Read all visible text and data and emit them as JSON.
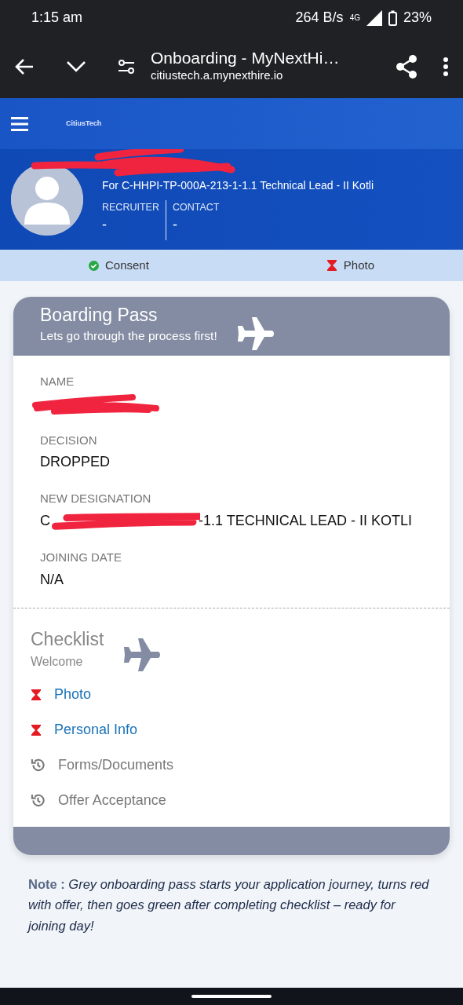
{
  "status_bar": {
    "time": "1:15 am",
    "speed": "264 B/s",
    "network": "4G",
    "battery": "23%"
  },
  "browser": {
    "title": "Onboarding - MyNextHi…",
    "url": "citiustech.a.mynexthire.io"
  },
  "header": {
    "logo": "CitiusTech"
  },
  "profile": {
    "for_label": "For",
    "position": "C-HHPI-TP-000A-213-1-1.1 Technical Lead - II Kotli",
    "fields": [
      {
        "label": "RECRUITER",
        "value": "-"
      },
      {
        "label": "CONTACT",
        "value": "-"
      }
    ]
  },
  "steps": [
    {
      "label": "Consent",
      "kind": "done"
    },
    {
      "label": "Photo",
      "kind": "pending"
    }
  ],
  "pass": {
    "title": "Boarding Pass",
    "subtitle": "Lets go through the process first!",
    "fields": [
      {
        "label": "NAME",
        "redacted": true
      },
      {
        "label": "DECISION",
        "value": "DROPPED"
      },
      {
        "label": "NEW DESIGNATION",
        "value_start": "C",
        "value": "-1.1 TECHNICAL LEAD - II KOTLI",
        "redacted": true
      },
      {
        "label": "JOINING DATE",
        "value": "N/A"
      }
    ]
  },
  "checklist": {
    "title": "Checklist",
    "subtitle": "Welcome",
    "items": [
      {
        "label": "Photo",
        "kind": "pending"
      },
      {
        "label": "Personal Info",
        "kind": "pending"
      },
      {
        "label": "Forms/Documents",
        "kind": "history"
      },
      {
        "label": "Offer Acceptance",
        "kind": "history"
      }
    ]
  },
  "note": {
    "label": "Note :",
    "text": "Grey onboarding pass starts your application journey, turns red with offer, then goes green after completing checklist – ready for joining day!"
  }
}
